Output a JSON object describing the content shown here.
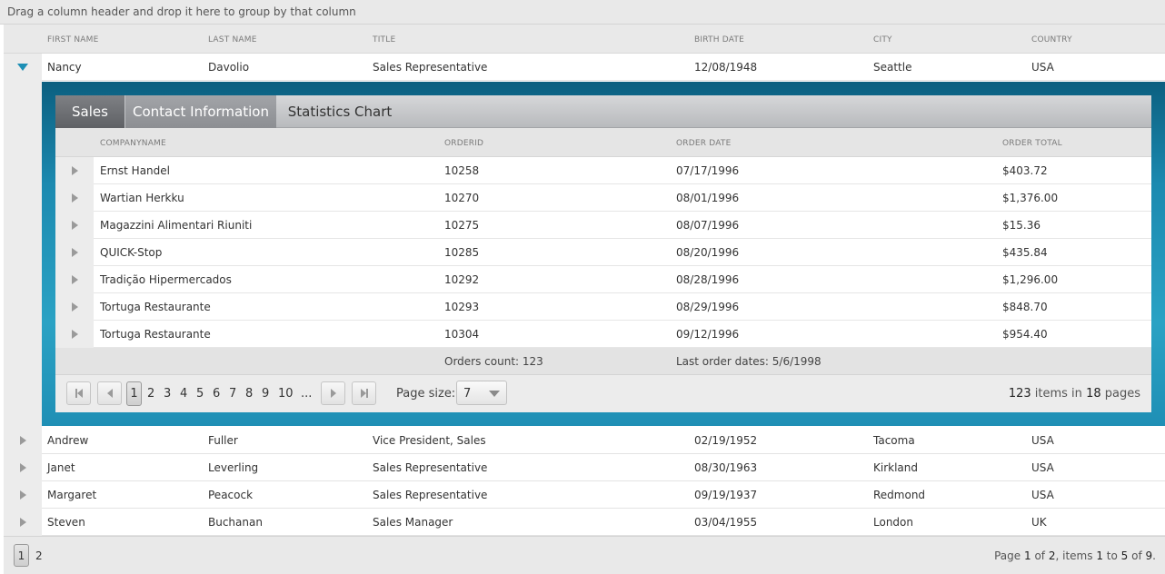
{
  "group_panel": {
    "text": "Drag a column header and drop it here to group by that column"
  },
  "master": {
    "columns": [
      "FIRST NAME",
      "LAST NAME",
      "TITLE",
      "BIRTH DATE",
      "CITY",
      "COUNTRY"
    ],
    "rows": [
      {
        "first": "Nancy",
        "last": "Davolio",
        "title": "Sales Representative",
        "birth": "12/08/1948",
        "city": "Seattle",
        "country": "USA"
      },
      {
        "first": "Andrew",
        "last": "Fuller",
        "title": "Vice President, Sales",
        "birth": "02/19/1952",
        "city": "Tacoma",
        "country": "USA"
      },
      {
        "first": "Janet",
        "last": "Leverling",
        "title": "Sales Representative",
        "birth": "08/30/1963",
        "city": "Kirkland",
        "country": "USA"
      },
      {
        "first": "Margaret",
        "last": "Peacock",
        "title": "Sales Representative",
        "birth": "09/19/1937",
        "city": "Redmond",
        "country": "USA"
      },
      {
        "first": "Steven",
        "last": "Buchanan",
        "title": "Sales Manager",
        "birth": "03/04/1955",
        "city": "London",
        "country": "UK"
      }
    ],
    "pager": {
      "pages": [
        "1",
        "2"
      ],
      "info_page_word": "Page",
      "current_page": "1",
      "of_word": "of",
      "total_pages": "2",
      "items_word": ", items",
      "from": "1",
      "to_word": "to",
      "to": "5",
      "of_word2": "of",
      "total_items": "9",
      "end": "."
    }
  },
  "detail": {
    "tabs": [
      "Sales",
      "Contact Information",
      "Statistics Chart"
    ],
    "columns": [
      "COMPANYNAME",
      "ORDERID",
      "ORDER DATE",
      "ORDER TOTAL"
    ],
    "rows": [
      {
        "company": "Ernst Handel",
        "orderid": "10258",
        "date": "07/17/1996",
        "total": "$403.72"
      },
      {
        "company": "Wartian Herkku",
        "orderid": "10270",
        "date": "08/01/1996",
        "total": "$1,376.00"
      },
      {
        "company": "Magazzini Alimentari Riuniti",
        "orderid": "10275",
        "date": "08/07/1996",
        "total": "$15.36"
      },
      {
        "company": "QUICK-Stop",
        "orderid": "10285",
        "date": "08/20/1996",
        "total": "$435.84"
      },
      {
        "company": "Tradição Hipermercados",
        "orderid": "10292",
        "date": "08/28/1996",
        "total": "$1,296.00"
      },
      {
        "company": "Tortuga Restaurante",
        "orderid": "10293",
        "date": "08/29/1996",
        "total": "$848.70"
      },
      {
        "company": "Tortuga Restaurante",
        "orderid": "10304",
        "date": "09/12/1996",
        "total": "$954.40"
      }
    ],
    "footer": {
      "orders_count": "Orders count: 123",
      "last_order": "Last order dates: 5/6/1998"
    },
    "pager": {
      "pages": [
        "1",
        "2",
        "3",
        "4",
        "5",
        "6",
        "7",
        "8",
        "9",
        "10",
        "..."
      ],
      "page_size_label": "Page size:",
      "page_size": "7",
      "total_items": "123",
      "items_in": "items in",
      "total_pages": "18",
      "pages_word": "pages"
    }
  }
}
